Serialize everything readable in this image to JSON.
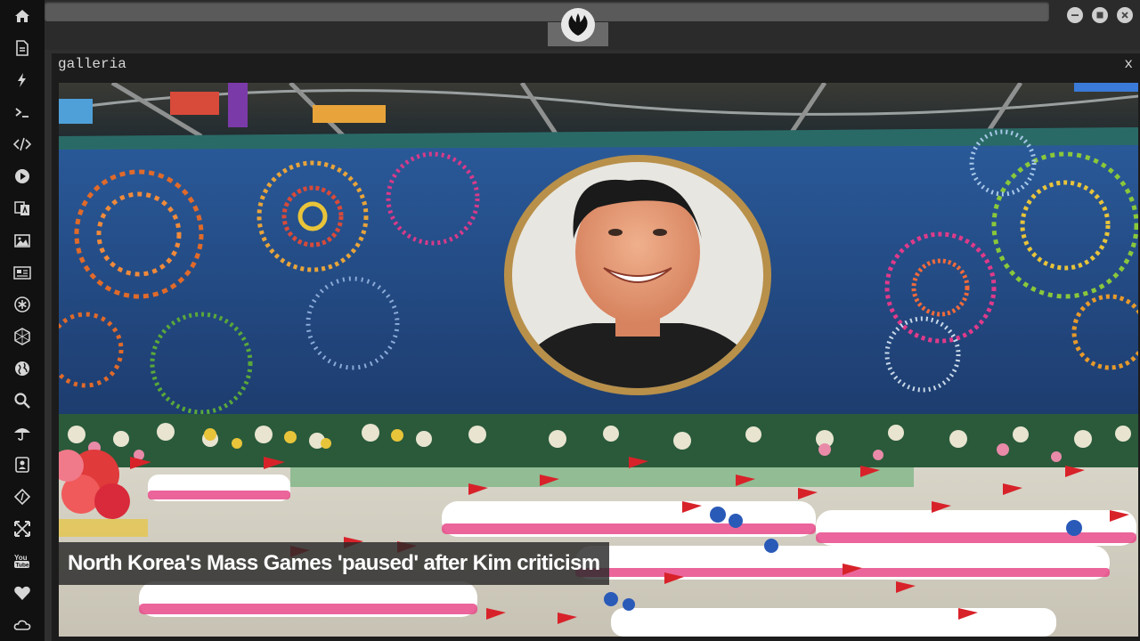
{
  "sidebar": {
    "items": [
      {
        "icon": "home-icon"
      },
      {
        "icon": "document-icon"
      },
      {
        "icon": "lightning-icon"
      },
      {
        "icon": "terminal-icon"
      },
      {
        "icon": "code-icon"
      },
      {
        "icon": "play-icon"
      },
      {
        "icon": "translate-icon"
      },
      {
        "icon": "image-icon"
      },
      {
        "icon": "newspaper-icon"
      },
      {
        "icon": "asterisk-icon"
      },
      {
        "icon": "hexagon-icon"
      },
      {
        "icon": "globe-icon"
      },
      {
        "icon": "search-icon"
      },
      {
        "icon": "umbrella-icon"
      },
      {
        "icon": "contact-icon"
      },
      {
        "icon": "code-diamond-icon"
      },
      {
        "icon": "expand-icon"
      },
      {
        "icon": "youtube-icon"
      },
      {
        "icon": "heart-icon"
      },
      {
        "icon": "cloud-icon"
      }
    ]
  },
  "window": {
    "logo_icon": "rebel-alliance-icon",
    "controls": [
      "minimize-icon",
      "maximize-icon",
      "close-icon"
    ]
  },
  "panel": {
    "title": "galleria",
    "close_label": "x"
  },
  "gallery": {
    "caption": "North Korea's Mass Games 'paused' after Kim criticism"
  },
  "colors": {
    "sidebar_bg": "#111111",
    "panel_bg": "#1c1c1c",
    "caption_text": "#ffffff"
  }
}
